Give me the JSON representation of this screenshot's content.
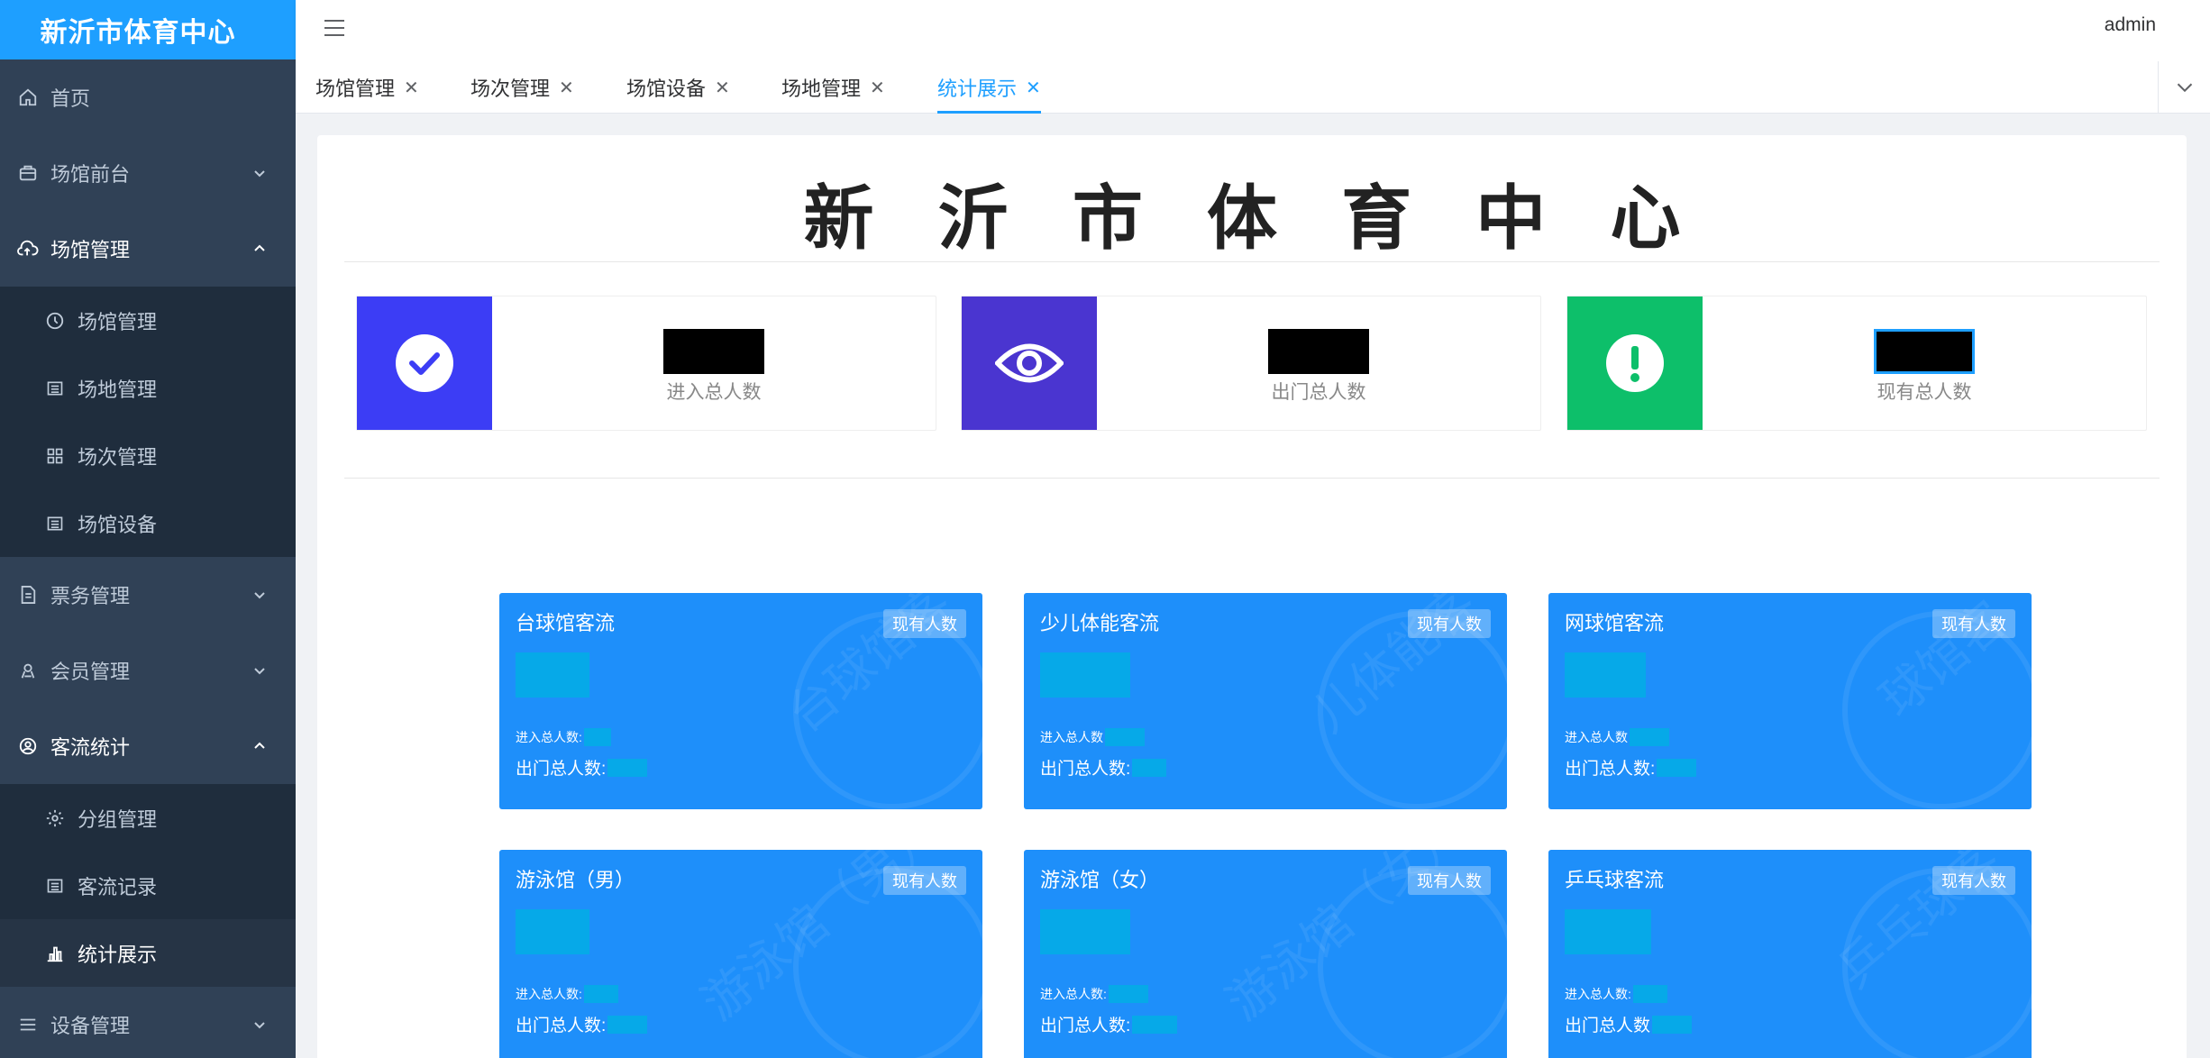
{
  "app": {
    "logo_text": "新沂市体育中心",
    "user": "admin"
  },
  "sidebar": {
    "items": [
      {
        "label": "首页",
        "icon": "home-icon"
      },
      {
        "label": "场馆前台",
        "icon": "store-icon"
      },
      {
        "label": "场馆管理",
        "icon": "cloud-icon"
      },
      {
        "label": "场馆管理",
        "icon": "clock-icon"
      },
      {
        "label": "场地管理",
        "icon": "list-icon"
      },
      {
        "label": "场次管理",
        "icon": "grid-icon"
      },
      {
        "label": "场馆设备",
        "icon": "list-icon"
      },
      {
        "label": "票务管理",
        "icon": "document-icon"
      },
      {
        "label": "会员管理",
        "icon": "user-medal-icon"
      },
      {
        "label": "客流统计",
        "icon": "user-circle-icon"
      },
      {
        "label": "分组管理",
        "icon": "gear-icon"
      },
      {
        "label": "客流记录",
        "icon": "list-icon"
      },
      {
        "label": "统计展示",
        "icon": "bar-chart-icon"
      },
      {
        "label": "设备管理",
        "icon": "menu-icon"
      }
    ]
  },
  "tabs": [
    {
      "label": "场馆管理"
    },
    {
      "label": "场次管理"
    },
    {
      "label": "场馆设备"
    },
    {
      "label": "场地管理"
    },
    {
      "label": "统计展示"
    }
  ],
  "main": {
    "title": "新 沂 市 体 育 中 心",
    "stats": [
      {
        "label": "进入总人数",
        "color": "#3c3df5",
        "icon": "check-circle-icon"
      },
      {
        "label": "出门总人数",
        "color": "#4a35d0",
        "icon": "eye-icon"
      },
      {
        "label": "现有总人数",
        "color": "#0dbf6a",
        "icon": "exclamation-icon"
      }
    ],
    "cards": [
      {
        "title": "台球馆客流",
        "badge": "现有人数",
        "in_label": "进入总人数:",
        "out_label": "出门总人数:",
        "watermark": "台球馆客"
      },
      {
        "title": "少儿体能客流",
        "badge": "现有人数",
        "in_label": "进入总人数",
        "out_label": "出门总人数:",
        "watermark": "儿体能客"
      },
      {
        "title": "网球馆客流",
        "badge": "现有人数",
        "in_label": "进入总人数",
        "out_label": "出门总人数:",
        "watermark": "球馆客"
      },
      {
        "title": "游泳馆（男）",
        "badge": "现有人数",
        "in_label": "进入总人数:",
        "out_label": "出门总人数:",
        "watermark": "游泳馆（男）"
      },
      {
        "title": "游泳馆（女）",
        "badge": "现有人数",
        "in_label": "进入总人数:",
        "out_label": "出门总人数:",
        "watermark": "游泳馆（女）"
      },
      {
        "title": "乒乓球客流",
        "badge": "现有人数",
        "in_label": "进入总人数:",
        "out_label": "出门总人数",
        "watermark": "乒乓球客"
      }
    ]
  },
  "colors": {
    "primary": "#1e9fff",
    "sidebar_bg": "#304156",
    "card_bg": "#1e8ffa"
  }
}
